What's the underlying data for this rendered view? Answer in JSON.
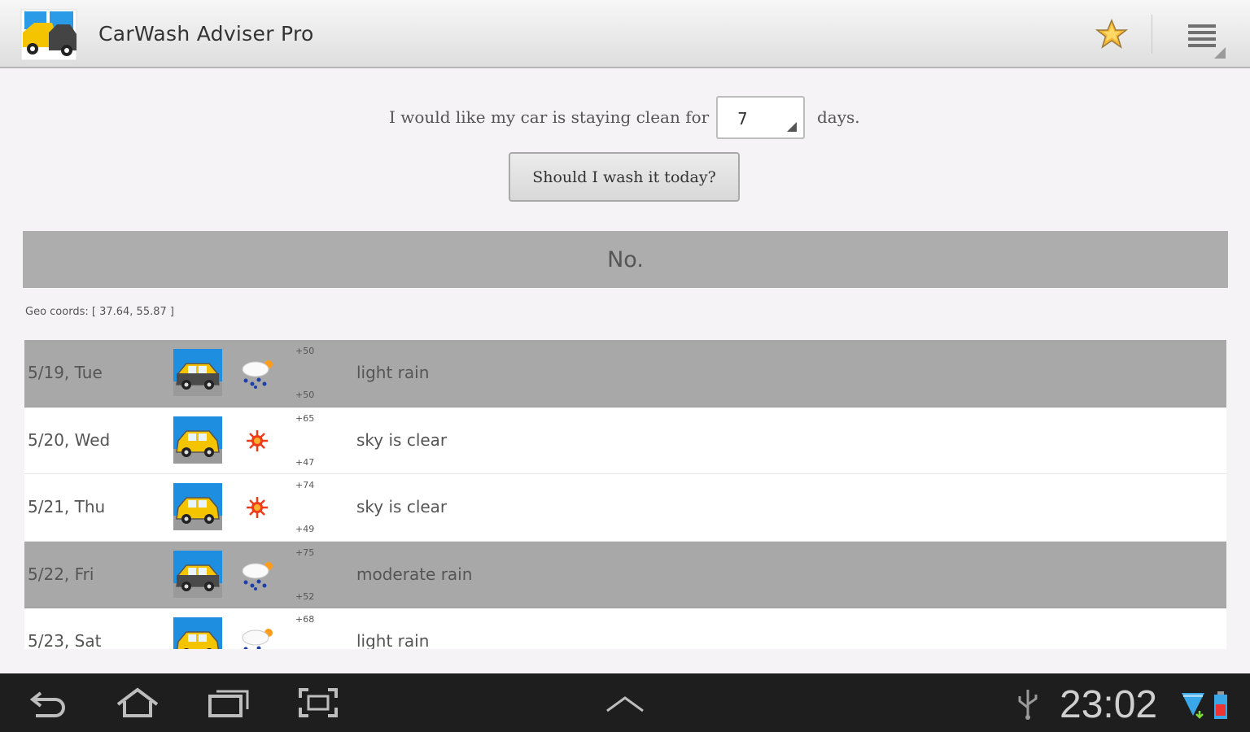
{
  "app": {
    "title": "CarWash Adviser Pro",
    "icon": "car-wash-app-icon"
  },
  "actions": {
    "favorite_icon": "star-icon",
    "menu_icon": "overflow-menu-icon"
  },
  "question": {
    "prefix": "I would like my car is staying clean for",
    "days_value": "7",
    "suffix": "days."
  },
  "wash_button": "Should I wash it today?",
  "answer": "No.",
  "geo": "Geo coords: [ 37.64, 55.87 ]",
  "forecast": [
    {
      "date": "5/19, Tue",
      "car": "dirty-car-icon",
      "weather": "rain-icon",
      "hi": "+50",
      "lo": "+50",
      "desc": "light rain",
      "rainy": true
    },
    {
      "date": "5/20, Wed",
      "car": "clean-car-icon",
      "weather": "sun-icon",
      "hi": "+65",
      "lo": "+47",
      "desc": "sky is clear",
      "rainy": false
    },
    {
      "date": "5/21, Thu",
      "car": "clean-car-icon",
      "weather": "sun-icon",
      "hi": "+74",
      "lo": "+49",
      "desc": "sky is clear",
      "rainy": false
    },
    {
      "date": "5/22, Fri",
      "car": "dirty-car-icon",
      "weather": "rain-icon",
      "hi": "+75",
      "lo": "+52",
      "desc": "moderate rain",
      "rainy": true
    },
    {
      "date": "5/23, Sat",
      "car": "clean-car-icon",
      "weather": "rain-icon",
      "hi": "+68",
      "lo": "",
      "desc": "light rain",
      "rainy": false
    }
  ],
  "status": {
    "time": "23:02",
    "icons": [
      "usb-icon",
      "wifi-icon",
      "battery-icon"
    ]
  },
  "nav": [
    "back-icon",
    "home-icon",
    "recent-apps-icon",
    "screenshot-icon",
    "expand-icon"
  ],
  "colors": {
    "rainy_row": "#a9a8a9",
    "answer_bar": "#aeadae",
    "car_yellow": "#f5c400",
    "sky_blue": "#1e8fe0"
  }
}
